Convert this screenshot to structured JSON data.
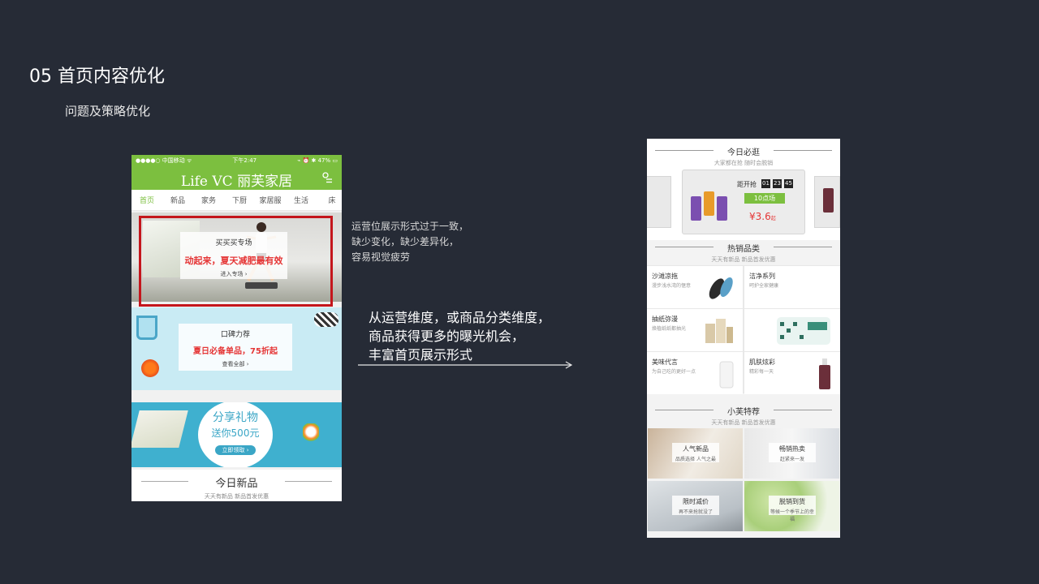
{
  "slide": {
    "title": "05  首页内容优化",
    "subtitle": "问题及策略优化"
  },
  "phone_left": {
    "status": {
      "carrier": "●●●●○ 中国移动 ᯤ",
      "time": "下午2:47",
      "battery": "⌁ ⏰ ✱ 47% ▭"
    },
    "brand": "Life VC 丽芙家居",
    "tabs": [
      {
        "label": "首页",
        "active": true
      },
      {
        "label": "新品"
      },
      {
        "label": "家务"
      },
      {
        "label": "下厨"
      },
      {
        "label": "家居服"
      },
      {
        "label": "生活"
      },
      {
        "label": "床"
      }
    ],
    "banner1": {
      "title": "买买买专场",
      "headline": "动起来，夏天减肥最有效",
      "cta": "进入专场 ›"
    },
    "banner2": {
      "title": "口碑力荐",
      "headline": "夏日必备单品，75折起",
      "cta": "查看全部 ›"
    },
    "banner3": {
      "line1": "分享礼物",
      "line2": "送你500元",
      "cta": "立即领取 ›"
    },
    "new_section": {
      "title": "今日新品",
      "subtitle": "天天有新品   新品首发优惠"
    }
  },
  "notes": {
    "problem_lines": [
      "运营位展示形式过于一致，",
      "缺少变化，缺少差异化，",
      "容易视觉疲劳"
    ],
    "strategy_lines": [
      "从运营维度，或商品分类维度，",
      "商品获得更多的曝光机会，",
      "丰富首页展示形式"
    ]
  },
  "phone_right": {
    "today": {
      "title": "今日必逛",
      "subtitle": "大家都在抢  随时会脱销",
      "countdown_label": "距开抢",
      "countdown": [
        "01",
        "23",
        "45"
      ],
      "tag": "10点场",
      "price": "¥3.6",
      "price_suffix": "起"
    },
    "hot": {
      "title": "热销品类",
      "subtitle": "天天有新品   新品首发优惠",
      "items": [
        {
          "name": "沙滩凉拖",
          "desc": "漫步浅水湾的惬意"
        },
        {
          "name": "洁净系列",
          "desc": "呵护全家健康"
        },
        {
          "name": "抽纸弥漫",
          "desc": "焕植纸纸都抽光"
        },
        {
          "name": "美味代言",
          "desc": "为自己吃的更好一点"
        },
        {
          "name": "肌肤炫彩",
          "desc": "精彩每一天"
        }
      ]
    },
    "recommend": {
      "title": "小芙特荐",
      "subtitle": "天天有新品   新品首发优惠",
      "items": [
        {
          "name": "人气新品",
          "desc": "品质选择 人气之最"
        },
        {
          "name": "畅销热卖",
          "desc": "赶紧来一发"
        },
        {
          "name": "限时减价",
          "desc": "再不来抢就没了"
        },
        {
          "name": "脱销到货",
          "desc": "等候一个季节上的幸福"
        }
      ]
    }
  },
  "colors": {
    "background": "#262b36",
    "brand_green": "#7cbf3f",
    "highlight_red": "#c4161c",
    "price_red": "#e53535"
  }
}
